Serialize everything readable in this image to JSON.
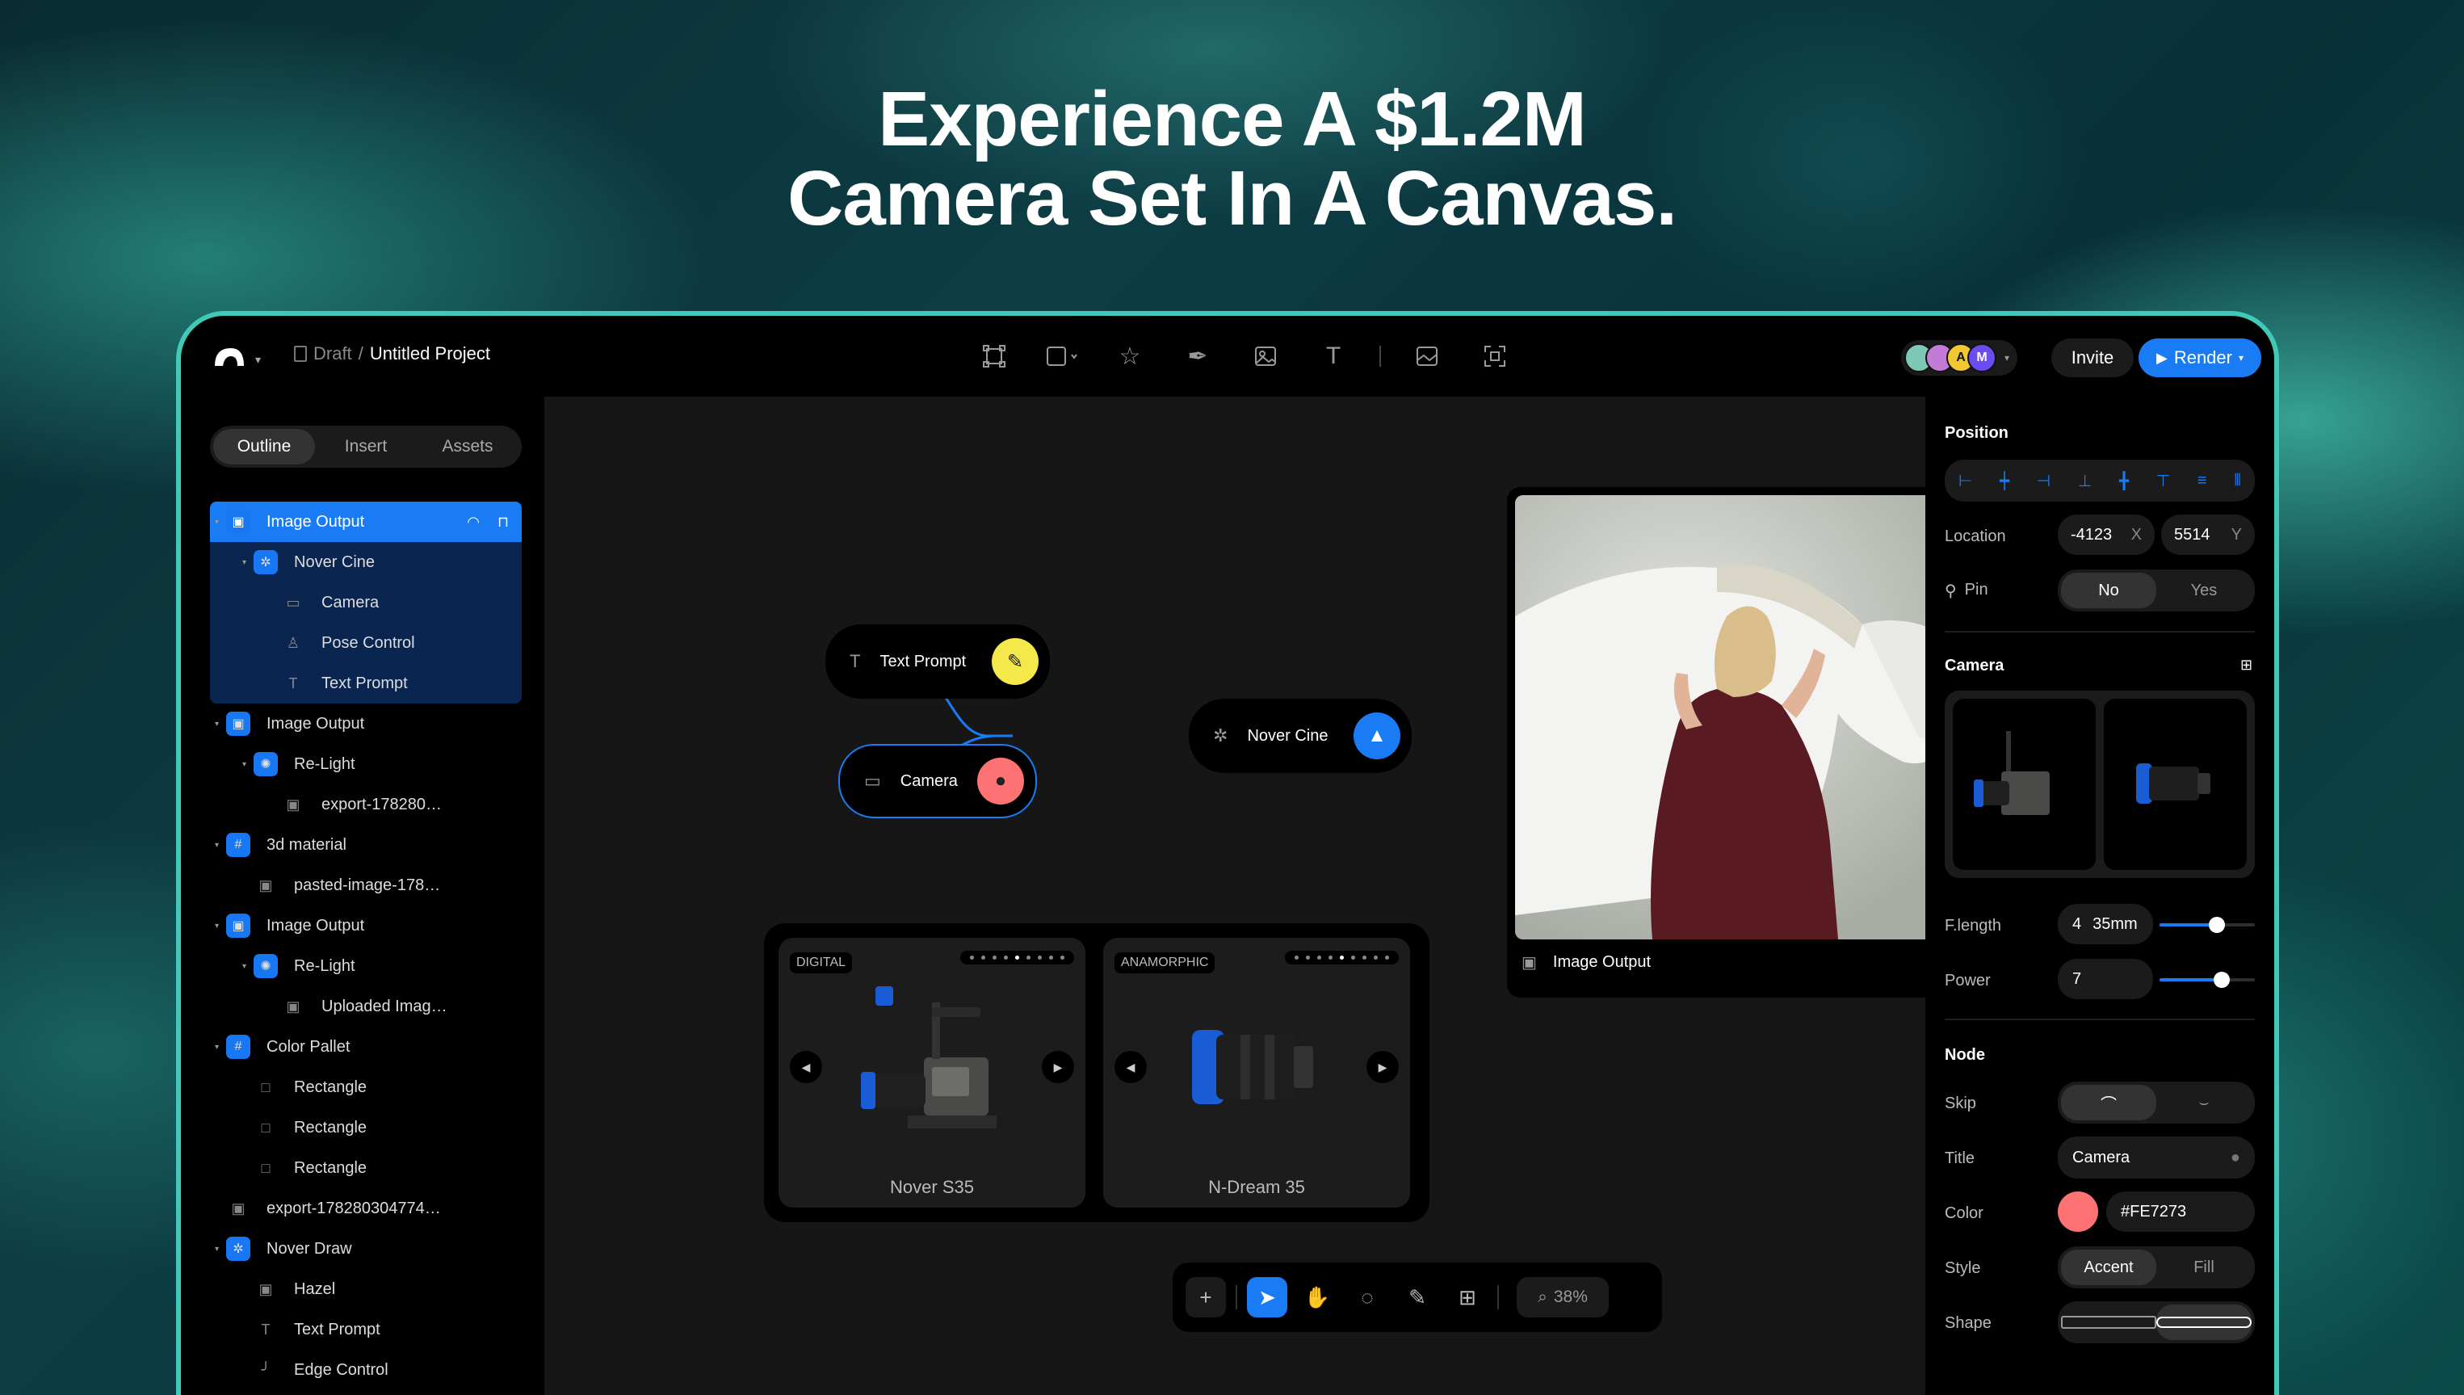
{
  "headline": {
    "line1": "Experience A $1.2M",
    "line2": "Camera Set In A Canvas."
  },
  "topbar": {
    "draft": "Draft",
    "sep": "/",
    "project": "Untitled Project",
    "invite": "Invite",
    "render": "Render",
    "avatars": [
      {
        "letter": "",
        "color": "#7ec8b8"
      },
      {
        "letter": "",
        "color": "#c47bd8"
      },
      {
        "letter": "A",
        "color": "#f2c832"
      },
      {
        "letter": "M",
        "color": "#6a4cf0"
      }
    ]
  },
  "left": {
    "tabs": [
      "Outline",
      "Insert",
      "Assets"
    ],
    "tree": [
      {
        "label": "Image Output",
        "level": 0,
        "icon": "image-icon",
        "blue": true,
        "caret": true
      },
      {
        "label": "Nover Cine",
        "level": 1,
        "icon": "gear-icon",
        "blue": true,
        "caret": true
      },
      {
        "label": "Camera",
        "level": 2,
        "icon": "video-icon",
        "blue": false
      },
      {
        "label": "Pose Control",
        "level": 2,
        "icon": "person-icon",
        "blue": false
      },
      {
        "label": "Text Prompt",
        "level": 2,
        "icon": "text-icon",
        "blue": false
      },
      {
        "label": "Image Output",
        "level": 0,
        "icon": "image-icon",
        "blue": true,
        "caret": true
      },
      {
        "label": "Re-Light",
        "level": 1,
        "icon": "bulb-icon",
        "blue": true,
        "caret": true
      },
      {
        "label": "export-178280…",
        "level": 2,
        "icon": "image-icon",
        "blue": false
      },
      {
        "label": "3d material",
        "level": 0,
        "icon": "frame-icon",
        "blue": true,
        "caret": true
      },
      {
        "label": "pasted-image-178…",
        "level": 1,
        "icon": "image-icon",
        "blue": false
      },
      {
        "label": "Image Output",
        "level": 0,
        "icon": "image-icon",
        "blue": true,
        "caret": true
      },
      {
        "label": "Re-Light",
        "level": 1,
        "icon": "bulb-icon",
        "blue": true,
        "caret": true
      },
      {
        "label": "Uploaded Imag…",
        "level": 2,
        "icon": "image-icon",
        "blue": false
      },
      {
        "label": "Color Pallet",
        "level": 0,
        "icon": "frame-icon",
        "blue": true,
        "caret": true
      },
      {
        "label": "Rectangle",
        "level": 1,
        "icon": "square-icon",
        "blue": false
      },
      {
        "label": "Rectangle",
        "level": 1,
        "icon": "square-icon",
        "blue": false
      },
      {
        "label": "Rectangle",
        "level": 1,
        "icon": "square-icon",
        "blue": false
      },
      {
        "label": "export-178280304774…",
        "level": 0,
        "icon": "image-icon",
        "blue": false
      },
      {
        "label": "Nover Draw",
        "level": 0,
        "icon": "gear-icon",
        "blue": true,
        "caret": true
      },
      {
        "label": "Hazel",
        "level": 1,
        "icon": "image-icon",
        "blue": false
      },
      {
        "label": "Text Prompt",
        "level": 1,
        "icon": "text-icon",
        "blue": false
      },
      {
        "label": "Edge Control",
        "level": 1,
        "icon": "curve-icon",
        "blue": false
      }
    ]
  },
  "canvas": {
    "nodes": {
      "text_prompt": "Text Prompt",
      "camera": "Camera",
      "nover_cine": "Nover Cine"
    },
    "image_output_label": "Image Output",
    "cards": [
      {
        "tag": "DIGITAL",
        "name": "Nover S35"
      },
      {
        "tag": "ANAMORPHIC",
        "name": "N-Dream 35"
      }
    ],
    "zoom": "38%"
  },
  "right": {
    "position": {
      "title": "Position",
      "location_label": "Location",
      "x": "-4123",
      "x_axis": "X",
      "y": "5514",
      "y_axis": "Y",
      "pin_label": "Pin",
      "pin_options": [
        "No",
        "Yes"
      ]
    },
    "camera": {
      "title": "Camera",
      "flength_label": "F.length",
      "flength_value": "4",
      "flength_unit": "35mm",
      "flength_level": 0.6,
      "power_label": "Power",
      "power_value": "7",
      "power_level": 0.65
    },
    "node": {
      "title": "Node",
      "skip_label": "Skip",
      "title_label": "Title",
      "title_value": "Camera",
      "color_label": "Color",
      "color_value": "#FE7273",
      "style_label": "Style",
      "style_options": [
        "Accent",
        "Fill"
      ],
      "shape_label": "Shape"
    }
  },
  "colors": {
    "accent": "#1a7cf5",
    "node_color": "#FE7273",
    "prompt_badge": "#f5e84a"
  }
}
